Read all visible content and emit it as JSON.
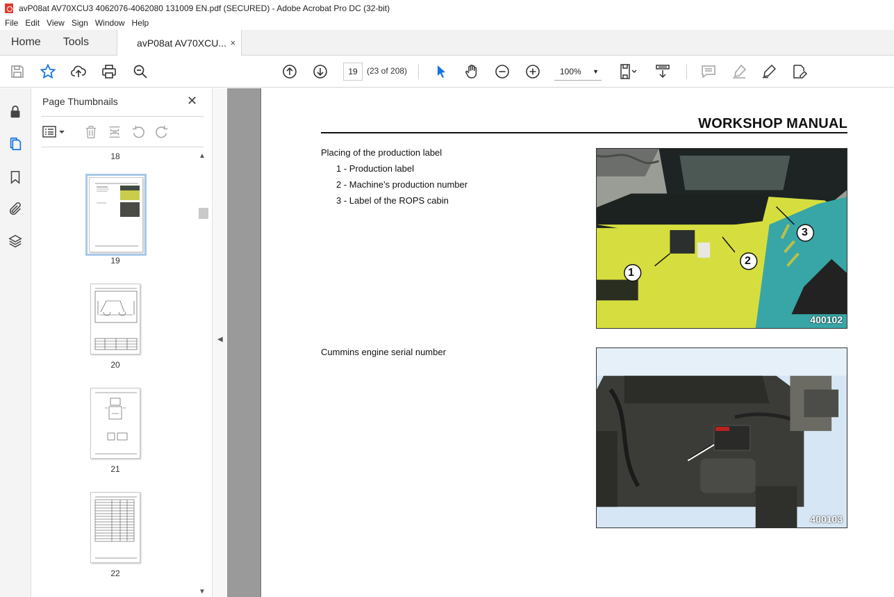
{
  "window": {
    "title": "avP08at AV70XCU3 4062076-4062080 131009 EN.pdf (SECURED) - Adobe Acrobat Pro DC (32-bit)"
  },
  "menu": [
    "File",
    "Edit",
    "View",
    "Sign",
    "Window",
    "Help"
  ],
  "tabs": {
    "home": "Home",
    "tools": "Tools",
    "document": "avP08at AV70XCU...",
    "close": "×"
  },
  "toolbar": {
    "page_current": "19",
    "page_count": "(23 of 208)",
    "zoom": "100%"
  },
  "panel": {
    "title": "Page Thumbnails",
    "close": "✕",
    "thumbnails": [
      "18",
      "19",
      "20",
      "21",
      "22"
    ],
    "selected": "19"
  },
  "document": {
    "heading": "WORKSHOP MANUAL",
    "section1": {
      "title": "Placing of the production label",
      "items": [
        "1 - Production label",
        "2 - Machine’s production number",
        "3 - Label of the ROPS cabin"
      ],
      "photo_code": "400102",
      "callouts": [
        "1",
        "2",
        "3"
      ]
    },
    "section2": {
      "title": "Cummins engine serial number",
      "photo_code": "400103"
    }
  },
  "colors": {
    "accent_blue": "#1473e6",
    "pdf_red": "#e03a2e",
    "machine_yellow": "#d9e34a",
    "teal": "#3fa8a8"
  }
}
